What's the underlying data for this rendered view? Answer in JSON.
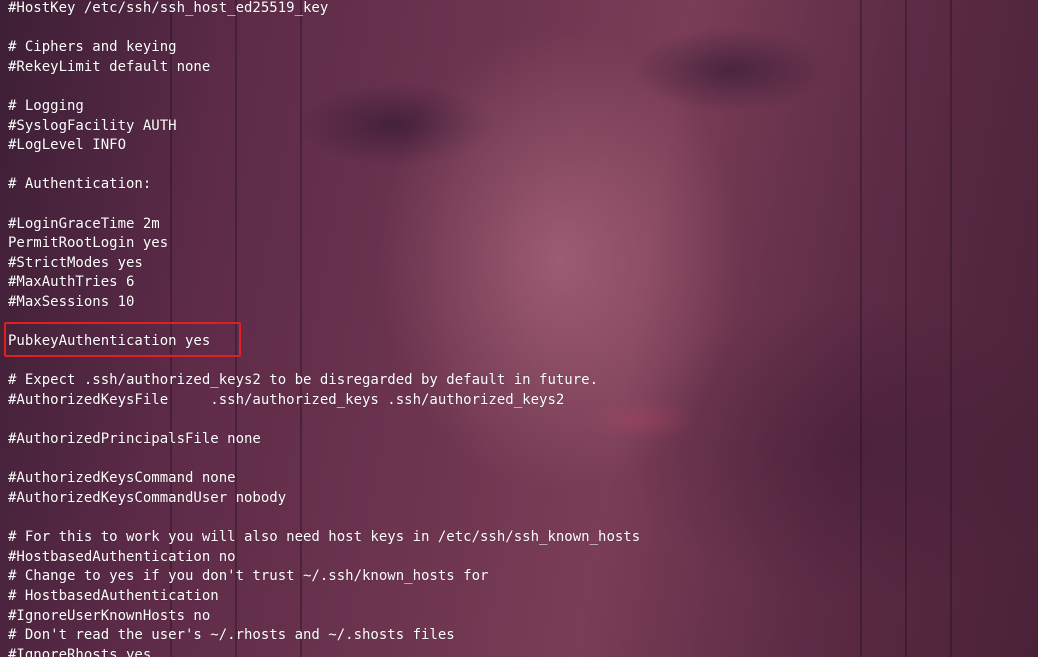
{
  "terminal": {
    "lines": [
      "#HostKey /etc/ssh/ssh_host_ed25519_key",
      "",
      "# Ciphers and keying",
      "#RekeyLimit default none",
      "",
      "# Logging",
      "#SyslogFacility AUTH",
      "#LogLevel INFO",
      "",
      "# Authentication:",
      "",
      "#LoginGraceTime 2m",
      "PermitRootLogin yes",
      "#StrictModes yes",
      "#MaxAuthTries 6",
      "#MaxSessions 10",
      "",
      "PubkeyAuthentication yes",
      "",
      "# Expect .ssh/authorized_keys2 to be disregarded by default in future.",
      "#AuthorizedKeysFile     .ssh/authorized_keys .ssh/authorized_keys2",
      "",
      "#AuthorizedPrincipalsFile none",
      "",
      "#AuthorizedKeysCommand none",
      "#AuthorizedKeysCommandUser nobody",
      "",
      "# For this to work you will also need host keys in /etc/ssh/ssh_known_hosts",
      "#HostbasedAuthentication no",
      "# Change to yes if you don't trust ~/.ssh/known_hosts for",
      "# HostbasedAuthentication",
      "#IgnoreUserKnownHosts no",
      "# Don't read the user's ~/.rhosts and ~/.shosts files",
      "#IgnoreRhosts yes"
    ],
    "highlighted_line": "PubkeyAuthentication yes",
    "text_color": "#ffffff",
    "highlight_color": "#e02020"
  }
}
